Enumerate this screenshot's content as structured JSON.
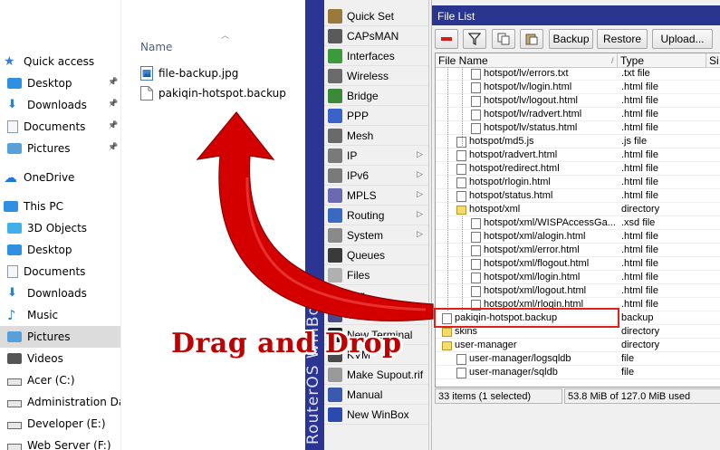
{
  "explorer": {
    "column_header": "Name",
    "nav": [
      {
        "label": "Quick access",
        "icon": "star-icon",
        "pinned": false,
        "selected": false
      },
      {
        "label": "Desktop",
        "icon": "desktop-folder-icon",
        "pinned": true,
        "selected": false
      },
      {
        "label": "Downloads",
        "icon": "download-arrow-icon",
        "pinned": true,
        "selected": false
      },
      {
        "label": "Documents",
        "icon": "documents-icon",
        "pinned": true,
        "selected": false
      },
      {
        "label": "Pictures",
        "icon": "pictures-icon",
        "pinned": true,
        "selected": false
      },
      {
        "label": "OneDrive",
        "icon": "cloud-icon",
        "pinned": false,
        "selected": false
      },
      {
        "label": "This PC",
        "icon": "computer-icon",
        "pinned": false,
        "selected": false
      },
      {
        "label": "3D Objects",
        "icon": "cube-icon",
        "pinned": false,
        "selected": false
      },
      {
        "label": "Desktop",
        "icon": "desktop-folder-icon",
        "pinned": false,
        "selected": false
      },
      {
        "label": "Documents",
        "icon": "documents-icon",
        "pinned": false,
        "selected": false
      },
      {
        "label": "Downloads",
        "icon": "download-arrow-icon",
        "pinned": false,
        "selected": false
      },
      {
        "label": "Music",
        "icon": "music-note-icon",
        "pinned": false,
        "selected": false
      },
      {
        "label": "Pictures",
        "icon": "pictures-icon",
        "pinned": false,
        "selected": true
      },
      {
        "label": "Videos",
        "icon": "video-icon",
        "pinned": false,
        "selected": false
      },
      {
        "label": "Acer (C:)",
        "icon": "drive-icon",
        "pinned": false,
        "selected": false
      },
      {
        "label": "Administration Data",
        "icon": "drive-icon",
        "pinned": false,
        "selected": false
      },
      {
        "label": "Developer (E:)",
        "icon": "drive-icon",
        "pinned": false,
        "selected": false
      },
      {
        "label": "Web Server (F:)",
        "icon": "drive-icon",
        "pinned": false,
        "selected": false
      }
    ],
    "files": [
      {
        "name": "file-backup.jpg",
        "icon": "image-file-icon"
      },
      {
        "name": "pakiqin-hotspot.backup",
        "icon": "backup-file-icon"
      }
    ]
  },
  "winbox": {
    "vertical_title": "RouterOS WinBox",
    "menu": [
      {
        "label": "Quick Set",
        "icon": "quick-set-icon",
        "color": "#9a7a3a",
        "submenu": false
      },
      {
        "label": "CAPsMAN",
        "icon": "capsman-icon",
        "color": "#5a5a5a",
        "submenu": false
      },
      {
        "label": "Interfaces",
        "icon": "interfaces-icon",
        "color": "#3c9a3c",
        "submenu": false
      },
      {
        "label": "Wireless",
        "icon": "wireless-icon",
        "color": "#6b6b6b",
        "submenu": false
      },
      {
        "label": "Bridge",
        "icon": "bridge-icon",
        "color": "#3a8a3a",
        "submenu": false
      },
      {
        "label": "PPP",
        "icon": "ppp-icon",
        "color": "#3a62c8",
        "submenu": false
      },
      {
        "label": "Mesh",
        "icon": "mesh-icon",
        "color": "#6a6a6a",
        "submenu": false
      },
      {
        "label": "IP",
        "icon": "ip-icon",
        "color": "#7a7a7a",
        "submenu": true
      },
      {
        "label": "IPv6",
        "icon": "ipv6-icon",
        "color": "#7a7a7a",
        "submenu": true
      },
      {
        "label": "MPLS",
        "icon": "mpls-icon",
        "color": "#6a6ab0",
        "submenu": true
      },
      {
        "label": "Routing",
        "icon": "routing-icon",
        "color": "#3a6ac0",
        "submenu": true
      },
      {
        "label": "System",
        "icon": "system-icon",
        "color": "#8a8a8a",
        "submenu": true
      },
      {
        "label": "Queues",
        "icon": "queues-icon",
        "color": "#3a3a3a",
        "submenu": false
      },
      {
        "label": "Files",
        "icon": "files-icon",
        "color": "#b0b0b0",
        "submenu": false
      },
      {
        "label": "Log",
        "icon": "log-icon",
        "color": "#c0c0c0",
        "submenu": false
      },
      {
        "label": "Tools",
        "icon": "tools-icon",
        "color": "#4a4a8a",
        "submenu": true
      },
      {
        "label": "New Terminal",
        "icon": "terminal-icon",
        "color": "#222222",
        "submenu": false
      },
      {
        "label": "KVM",
        "icon": "kvm-icon",
        "color": "#4a4a4a",
        "submenu": false
      },
      {
        "label": "Make Supout.rif",
        "icon": "supout-icon",
        "color": "#9a9a9a",
        "submenu": false
      },
      {
        "label": "Manual",
        "icon": "manual-icon",
        "color": "#3a5ab0",
        "submenu": false
      },
      {
        "label": "New WinBox",
        "icon": "winbox-icon",
        "color": "#2a4ab0",
        "submenu": false
      }
    ],
    "file_list": {
      "title": "File List",
      "toolbar": {
        "remove_icon": "minus-icon",
        "filter_icon": "filter-icon",
        "copy_icon": "copy-icon",
        "paste_icon": "paste-icon",
        "backup": "Backup",
        "restore": "Restore",
        "upload": "Upload..."
      },
      "columns": {
        "name": "File Name",
        "type": "Type",
        "size": "Si"
      },
      "rows": [
        {
          "name": "hotspot/lv/errors.txt",
          "type": ".txt file",
          "depth": 2,
          "folder": false
        },
        {
          "name": "hotspot/lv/login.html",
          "type": ".html file",
          "depth": 2,
          "folder": false
        },
        {
          "name": "hotspot/lv/logout.html",
          "type": ".html file",
          "depth": 2,
          "folder": false
        },
        {
          "name": "hotspot/lv/radvert.html",
          "type": ".html file",
          "depth": 2,
          "folder": false
        },
        {
          "name": "hotspot/lv/status.html",
          "type": ".html file",
          "depth": 2,
          "folder": false
        },
        {
          "name": "hotspot/md5.js",
          "type": ".js file",
          "depth": 1,
          "folder": false
        },
        {
          "name": "hotspot/radvert.html",
          "type": ".html file",
          "depth": 1,
          "folder": false
        },
        {
          "name": "hotspot/redirect.html",
          "type": ".html file",
          "depth": 1,
          "folder": false
        },
        {
          "name": "hotspot/rlogin.html",
          "type": ".html file",
          "depth": 1,
          "folder": false
        },
        {
          "name": "hotspot/status.html",
          "type": ".html file",
          "depth": 1,
          "folder": false
        },
        {
          "name": "hotspot/xml",
          "type": "directory",
          "depth": 1,
          "folder": true
        },
        {
          "name": "hotspot/xml/WISPAccessGa...",
          "type": ".xsd file",
          "depth": 2,
          "folder": false
        },
        {
          "name": "hotspot/xml/alogin.html",
          "type": ".html file",
          "depth": 2,
          "folder": false
        },
        {
          "name": "hotspot/xml/error.html",
          "type": ".html file",
          "depth": 2,
          "folder": false
        },
        {
          "name": "hotspot/xml/flogout.html",
          "type": ".html file",
          "depth": 2,
          "folder": false
        },
        {
          "name": "hotspot/xml/login.html",
          "type": ".html file",
          "depth": 2,
          "folder": false
        },
        {
          "name": "hotspot/xml/logout.html",
          "type": ".html file",
          "depth": 2,
          "folder": false
        },
        {
          "name": "hotspot/xml/rlogin.html",
          "type": ".html file",
          "depth": 2,
          "folder": false
        },
        {
          "name": "pakiqin-hotspot.backup",
          "type": "backup",
          "depth": 0,
          "folder": false
        },
        {
          "name": "skins",
          "type": "directory",
          "depth": 0,
          "folder": true
        },
        {
          "name": "user-manager",
          "type": "directory",
          "depth": 0,
          "folder": true
        },
        {
          "name": "user-manager/logsqldb",
          "type": "file",
          "depth": 1,
          "folder": false
        },
        {
          "name": "user-manager/sqldb",
          "type": "file",
          "depth": 1,
          "folder": false
        }
      ],
      "status": {
        "items": "33 items (1 selected)",
        "storage": "53.8 MiB of 127.0 MiB used"
      }
    }
  },
  "overlay": {
    "caption": "Drag and Drop",
    "arrow_color": "#d40000",
    "highlight_color": "#e01e1e"
  }
}
